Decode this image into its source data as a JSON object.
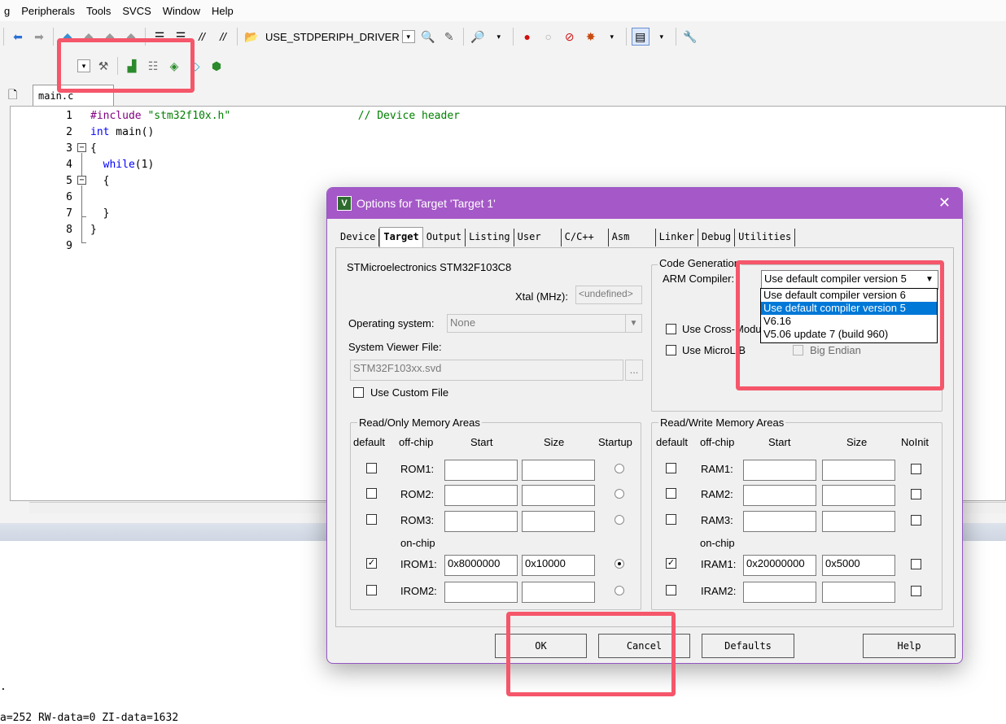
{
  "menu": [
    "g",
    "Peripherals",
    "Tools",
    "SVCS",
    "Window",
    "Help"
  ],
  "toolbar": {
    "target_define": "USE_STDPERIPH_DRIVER"
  },
  "editor": {
    "file_tab": "main.c",
    "lines": [
      {
        "n": "1",
        "parts": [
          {
            "t": "#include ",
            "c": "pp"
          },
          {
            "t": "\"stm32f10x.h\"",
            "c": "str"
          },
          {
            "t": "                    ",
            "c": ""
          },
          {
            "t": "// Device header",
            "c": "cm"
          }
        ]
      },
      {
        "n": "2",
        "parts": [
          {
            "t": "int",
            "c": "kw"
          },
          {
            "t": " main()",
            "c": ""
          }
        ]
      },
      {
        "n": "3",
        "parts": [
          {
            "t": "{",
            "c": ""
          }
        ]
      },
      {
        "n": "4",
        "parts": [
          {
            "t": "  ",
            "c": ""
          },
          {
            "t": "while",
            "c": "kw"
          },
          {
            "t": "(1)",
            "c": ""
          }
        ]
      },
      {
        "n": "5",
        "parts": [
          {
            "t": "  {",
            "c": ""
          }
        ]
      },
      {
        "n": "6",
        "parts": []
      },
      {
        "n": "7",
        "parts": [
          {
            "t": "  }",
            "c": ""
          }
        ]
      },
      {
        "n": "8",
        "parts": [
          {
            "t": "}",
            "c": ""
          }
        ]
      },
      {
        "n": "9",
        "parts": []
      }
    ]
  },
  "build_output": {
    "dot": ".",
    "line": "a=252 RW-data=0 ZI-data=1632"
  },
  "dialog": {
    "title": "Options for Target 'Target 1'",
    "close": "✕",
    "tabs": [
      "Device",
      "Target",
      "Output",
      "Listing",
      "User",
      "C/C++",
      "Asm",
      "Linker",
      "Debug",
      "Utilities"
    ],
    "active_tab": "Target",
    "device_name": "STMicroelectronics STM32F103C8",
    "xtal_label": "Xtal (MHz):",
    "xtal_value": "<undefined>",
    "os_label": "Operating system:",
    "os_value": "None",
    "svd_label": "System Viewer File:",
    "svd_value": "STM32F103xx.svd",
    "browse": "...",
    "use_custom_file": "Use Custom File",
    "code_gen": {
      "title": "Code Generation",
      "arm_compiler_label": "ARM Compiler:",
      "compiler_value": "Use default compiler version 5",
      "options": [
        "Use default compiler version 6",
        "Use default compiler version 5",
        "V6.16",
        "V5.06 update 7 (build 960)"
      ],
      "selected_index": 1,
      "cross_module": "Use Cross-Module",
      "microlib": "Use MicroLIB",
      "big_endian": "Big Endian"
    },
    "ro_memory": {
      "title": "Read/Only Memory Areas",
      "headers": [
        "default",
        "off-chip",
        "Start",
        "Size",
        "Startup"
      ],
      "on_chip_label": "on-chip",
      "rows": [
        {
          "name": "ROM1:",
          "default": false,
          "start": "",
          "size": "",
          "startup": false
        },
        {
          "name": "ROM2:",
          "default": false,
          "start": "",
          "size": "",
          "startup": false
        },
        {
          "name": "ROM3:",
          "default": false,
          "start": "",
          "size": "",
          "startup": false
        },
        {
          "name": "IROM1:",
          "default": true,
          "start": "0x8000000",
          "size": "0x10000",
          "startup": true
        },
        {
          "name": "IROM2:",
          "default": false,
          "start": "",
          "size": "",
          "startup": false
        }
      ]
    },
    "rw_memory": {
      "title": "Read/Write Memory Areas",
      "headers": [
        "default",
        "off-chip",
        "Start",
        "Size",
        "NoInit"
      ],
      "on_chip_label": "on-chip",
      "rows": [
        {
          "name": "RAM1:",
          "default": false,
          "start": "",
          "size": "",
          "noinit": false
        },
        {
          "name": "RAM2:",
          "default": false,
          "start": "",
          "size": "",
          "noinit": false
        },
        {
          "name": "RAM3:",
          "default": false,
          "start": "",
          "size": "",
          "noinit": false
        },
        {
          "name": "IRAM1:",
          "default": true,
          "start": "0x20000000",
          "size": "0x5000",
          "noinit": false
        },
        {
          "name": "IRAM2:",
          "default": false,
          "start": "",
          "size": "",
          "noinit": false
        }
      ]
    },
    "buttons": {
      "ok": "OK",
      "cancel": "Cancel",
      "defaults": "Defaults",
      "help": "Help"
    }
  },
  "colors": {
    "highlight": "#f5566a",
    "title_bar": "#a558c7",
    "selection": "#0078d7"
  }
}
